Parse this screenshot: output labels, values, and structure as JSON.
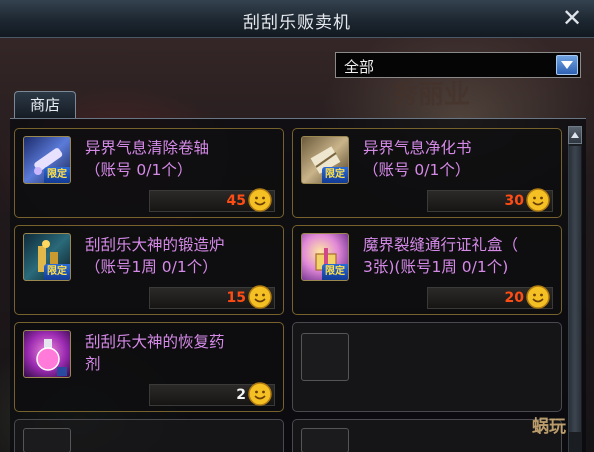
{
  "window": {
    "title": "刮刮乐贩卖机"
  },
  "filter": {
    "selected": "全部"
  },
  "tabs": [
    {
      "label": "商店"
    }
  ],
  "items": [
    {
      "name_line1": "异界气息清除卷轴",
      "name_line2": "（账号 0/1个）",
      "badge": "限定",
      "price": "45",
      "icon": "scroll-icon"
    },
    {
      "name_line1": "异界气息净化书",
      "name_line2": "（账号 0/1个）",
      "badge": "限定",
      "price": "30",
      "icon": "book-icon"
    },
    {
      "name_line1": "刮刮乐大神的锻造炉",
      "name_line2": "（账号1周 0/1个）",
      "badge": "限定",
      "price": "15",
      "icon": "forge-icon"
    },
    {
      "name_line1": "魔界裂缝通行证礼盒（",
      "name_line2": "3张)(账号1周 0/1个)",
      "badge": "限定",
      "price": "20",
      "icon": "giftbox-icon"
    },
    {
      "name_line1": "刮刮乐大神的恢复药",
      "name_line2": "剂",
      "badge": "",
      "price": "2",
      "icon": "potion-icon"
    }
  ],
  "watermark": "蜗玩",
  "colors": {
    "item_name": "#d58ae8",
    "price": "#ff4c14",
    "card_border": "#77622d"
  }
}
